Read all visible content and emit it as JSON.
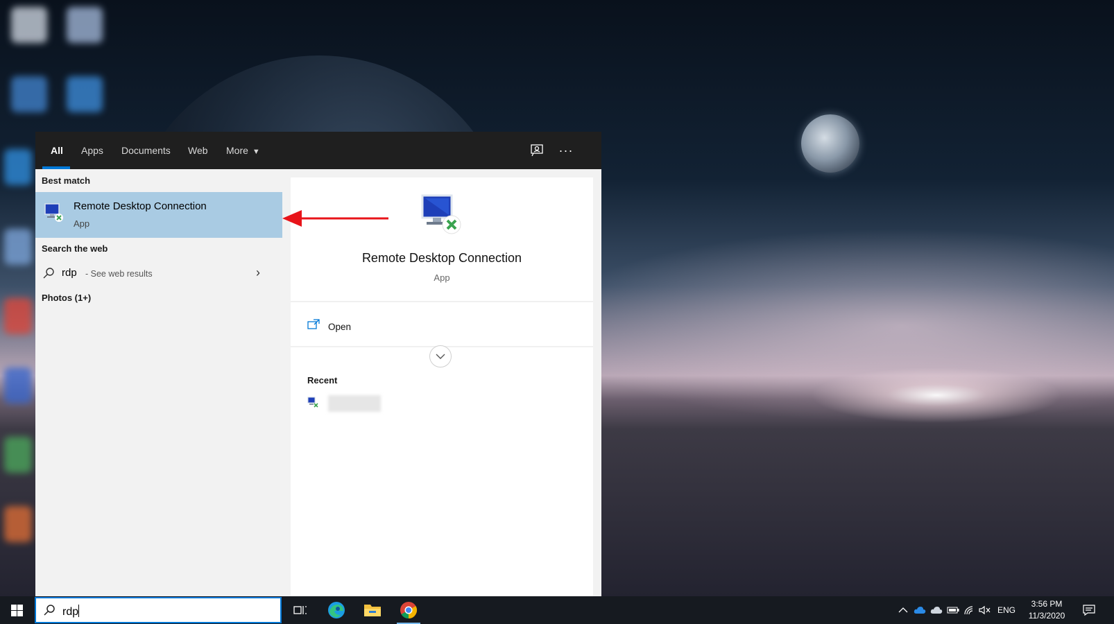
{
  "search_panel": {
    "tabs": [
      {
        "label": "All"
      },
      {
        "label": "Apps"
      },
      {
        "label": "Documents"
      },
      {
        "label": "Web"
      },
      {
        "label": "More"
      }
    ],
    "feedback_icon": "feedback-icon",
    "more_options_icon": "ellipsis-icon",
    "best_match_label": "Best match",
    "best_match": {
      "title": "Remote Desktop Connection",
      "subtitle": "App",
      "icon": "remote-desktop-icon"
    },
    "search_web_label": "Search the web",
    "web_result": {
      "query": "rdp",
      "hint": "- See web results"
    },
    "photos_label": "Photos (1+)",
    "detail": {
      "title": "Remote Desktop Connection",
      "type": "App",
      "open_label": "Open",
      "recent_label": "Recent"
    }
  },
  "taskbar": {
    "search_value": "rdp",
    "apps": [
      "task-view-icon",
      "edge-icon",
      "file-explorer-icon",
      "chrome-icon"
    ],
    "tray": {
      "language": "ENG",
      "time": "3:56 PM",
      "date": "11/3/2020"
    }
  },
  "colors": {
    "accent": "#0078d7",
    "selected_row": "#a9cbe3",
    "annotation_arrow": "#e8141a",
    "taskbar": "#161a20",
    "tabs_bar": "#1f1f1f"
  }
}
